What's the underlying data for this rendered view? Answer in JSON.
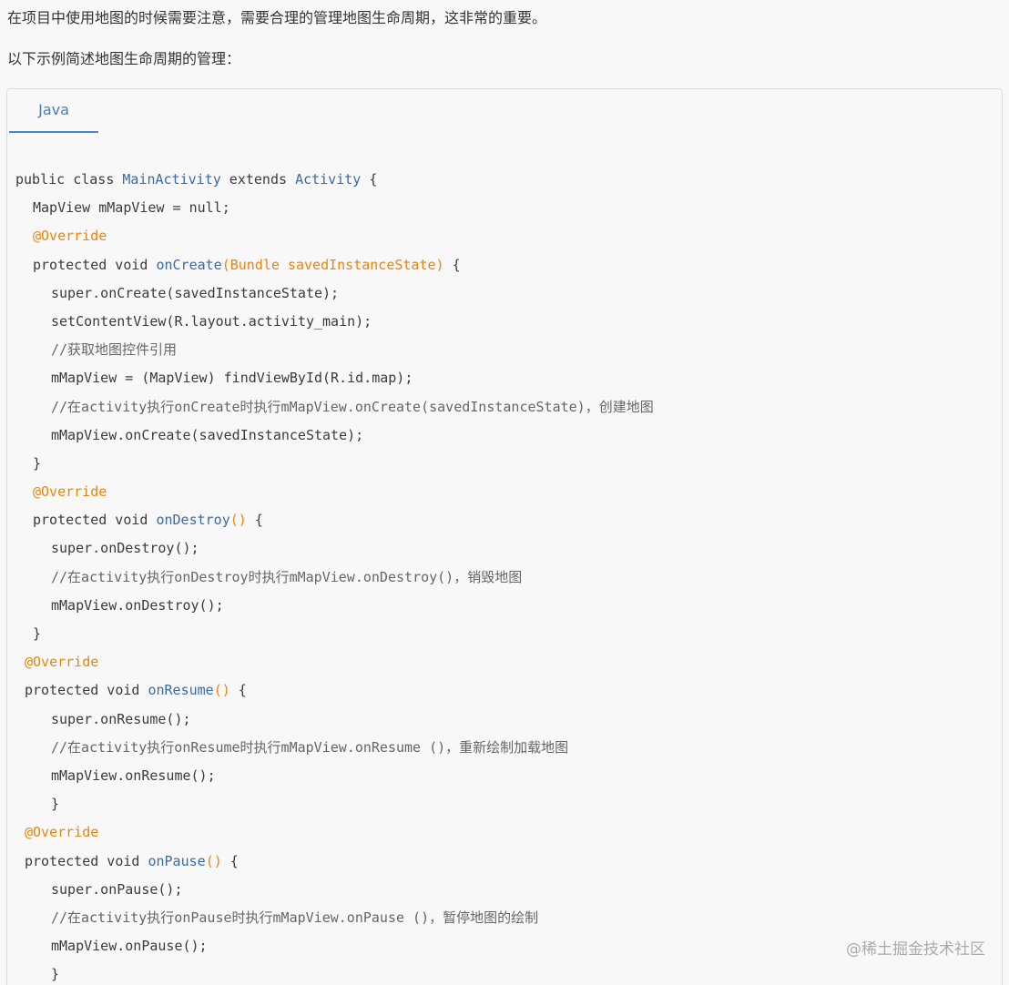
{
  "intro": {
    "line1": "在项目中使用地图的时候需要注意，需要合理的管理地图生命周期，这非常的重要。",
    "line2": "以下示例简述地图生命周期的管理："
  },
  "code_block": {
    "tab_label": "Java",
    "lines": {
      "l1": {
        "a": "public class ",
        "b": "MainActivity",
        "c": " extends ",
        "d": "Activity",
        "e": " {"
      },
      "l2": "MapView mMapView = null;",
      "l3": "@Override",
      "l4": {
        "a": "protected void ",
        "b": "onCreate",
        "c": "(Bundle savedInstanceState)",
        "d": " {"
      },
      "l5": "super.onCreate(savedInstanceState);",
      "l6": "setContentView(R.layout.activity_main);",
      "l7": "//获取地图控件引用",
      "l8": "mMapView = (MapView) findViewById(R.id.map);",
      "l9": "//在activity执行onCreate时执行mMapView.onCreate(savedInstanceState)，创建地图",
      "l10": "mMapView.onCreate(savedInstanceState);",
      "l11": "}",
      "l12": "@Override",
      "l13": {
        "a": "protected void ",
        "b": "onDestroy",
        "c": "()",
        "d": " {"
      },
      "l14": "super.onDestroy();",
      "l15": "//在activity执行onDestroy时执行mMapView.onDestroy()，销毁地图",
      "l16": "mMapView.onDestroy();",
      "l17": "}",
      "l18": "@Override",
      "l19": {
        "a": "protected void ",
        "b": "onResume",
        "c": "()",
        "d": " {"
      },
      "l20": "super.onResume();",
      "l21": "//在activity执行onResume时执行mMapView.onResume ()，重新绘制加载地图",
      "l22": "mMapView.onResume();",
      "l23": "}",
      "l24": "@Override",
      "l25": {
        "a": "protected void ",
        "b": "onPause",
        "c": "()",
        "d": " {"
      },
      "l26": "super.onPause();",
      "l27": "//在activity执行onPause时执行mMapView.onPause ()，暂停地图的绘制",
      "l28": "mMapView.onPause();",
      "l29": "}"
    }
  },
  "watermark": "@稀土掘金技术社区",
  "colors": {
    "keyword": "#3b3b3b",
    "class_name": "#3b6aa6",
    "annotation": "#e8860f",
    "tab_accent": "#4a86c5"
  }
}
